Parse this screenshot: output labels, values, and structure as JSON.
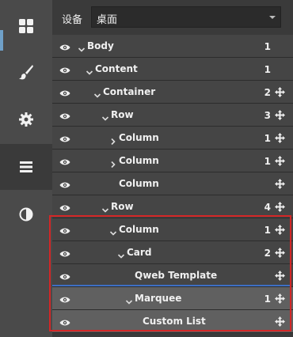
{
  "device": {
    "label": "设备",
    "value": "桌面"
  },
  "sidebar": {
    "items": [
      {
        "name": "blocks",
        "icon": "blocks-icon"
      },
      {
        "name": "theme",
        "icon": "brush-icon"
      },
      {
        "name": "options",
        "icon": "gear-icon"
      },
      {
        "name": "layers",
        "icon": "list-icon",
        "active": true
      },
      {
        "name": "contrast",
        "icon": "contrast-icon"
      }
    ]
  },
  "tree": [
    {
      "label": "Body",
      "level": 0,
      "toggle": "down",
      "count": "1",
      "movable": false
    },
    {
      "label": "Content",
      "level": 1,
      "toggle": "down",
      "count": "1",
      "movable": false
    },
    {
      "label": "Container",
      "level": 2,
      "toggle": "down",
      "count": "2",
      "movable": true
    },
    {
      "label": "Row",
      "level": 3,
      "toggle": "down",
      "count": "3",
      "movable": true
    },
    {
      "label": "Column",
      "level": 4,
      "toggle": "right",
      "count": "1",
      "movable": true
    },
    {
      "label": "Column",
      "level": 4,
      "toggle": "right",
      "count": "1",
      "movable": true
    },
    {
      "label": "Column",
      "level": 4,
      "toggle": "none",
      "count": "",
      "movable": true
    },
    {
      "label": "Row",
      "level": 3,
      "toggle": "down",
      "count": "4",
      "movable": true
    },
    {
      "label": "Column",
      "level": 4,
      "toggle": "down",
      "count": "1",
      "movable": true
    },
    {
      "label": "Card",
      "level": 5,
      "toggle": "down",
      "count": "2",
      "movable": true
    },
    {
      "label": "Qweb Template",
      "level": 6,
      "toggle": "none",
      "count": "",
      "movable": true
    },
    {
      "label": "Marquee",
      "level": 6,
      "toggle": "down",
      "count": "1",
      "movable": true,
      "highlighted": true
    },
    {
      "label": "Custom List",
      "level": 7,
      "toggle": "none",
      "count": "",
      "movable": true,
      "highlighted": true
    }
  ],
  "colors": {
    "selection_box": "#d42626",
    "drop_indicator": "#3d6fc4",
    "accent": "#6fa0c8"
  }
}
